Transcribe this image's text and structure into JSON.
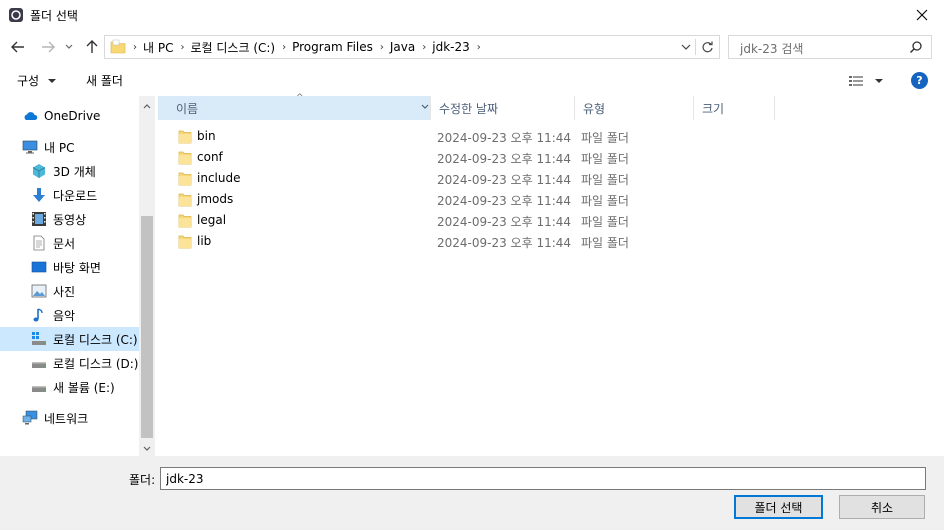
{
  "window": {
    "title": "폴더 선택"
  },
  "nav": {
    "breadcrumbs": [
      "내 PC",
      "로컬 디스크 (C:)",
      "Program Files",
      "Java",
      "jdk-23"
    ],
    "search_placeholder": "jdk-23 검색"
  },
  "toolbar": {
    "organize": "구성",
    "new_folder": "새 폴더"
  },
  "sidebar": {
    "items": [
      {
        "label": "OneDrive",
        "icon": "cloud-icon"
      },
      {
        "label": "내 PC",
        "icon": "computer-icon"
      },
      {
        "label": "3D 개체",
        "icon": "cube-icon"
      },
      {
        "label": "다운로드",
        "icon": "download-arrow-icon"
      },
      {
        "label": "동영상",
        "icon": "film-icon"
      },
      {
        "label": "문서",
        "icon": "document-icon"
      },
      {
        "label": "바탕 화면",
        "icon": "desktop-icon"
      },
      {
        "label": "사진",
        "icon": "picture-icon"
      },
      {
        "label": "음악",
        "icon": "music-note-icon"
      },
      {
        "label": "로컬 디스크 (C:)",
        "icon": "drive-windows-icon"
      },
      {
        "label": "로컬 디스크 (D:)",
        "icon": "drive-icon"
      },
      {
        "label": "새 볼륨 (E:)",
        "icon": "drive-icon"
      },
      {
        "label": "네트워크",
        "icon": "network-icon"
      }
    ]
  },
  "table": {
    "headers": {
      "name": "이름",
      "modified": "수정한 날짜",
      "type": "유형",
      "size": "크기"
    },
    "rows": [
      {
        "name": "bin",
        "modified": "2024-09-23 오후 11:44",
        "type": "파일 폴더"
      },
      {
        "name": "conf",
        "modified": "2024-09-23 오후 11:44",
        "type": "파일 폴더"
      },
      {
        "name": "include",
        "modified": "2024-09-23 오후 11:44",
        "type": "파일 폴더"
      },
      {
        "name": "jmods",
        "modified": "2024-09-23 오후 11:44",
        "type": "파일 폴더"
      },
      {
        "name": "legal",
        "modified": "2024-09-23 오후 11:44",
        "type": "파일 폴더"
      },
      {
        "name": "lib",
        "modified": "2024-09-23 오후 11:44",
        "type": "파일 폴더"
      }
    ]
  },
  "footer": {
    "folder_label": "폴더:",
    "folder_value": "jdk-23",
    "select_button": "폴더 선택",
    "cancel_button": "취소"
  },
  "colors": {
    "selection": "#cce8ff",
    "header_active": "#d9ebf9",
    "accent": "#0078d7",
    "folder": "#f8d775"
  }
}
